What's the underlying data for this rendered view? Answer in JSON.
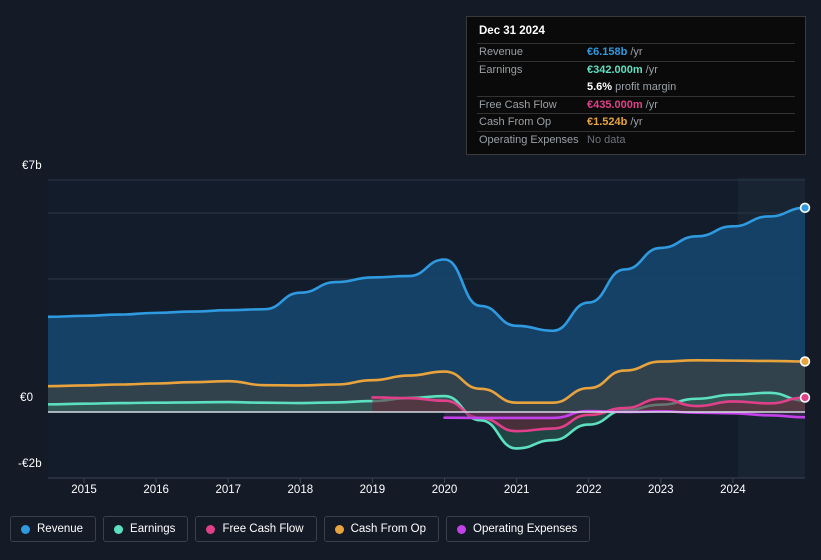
{
  "tooltip": {
    "title": "Dec 31 2024",
    "rows": [
      {
        "label": "Revenue",
        "value": "€6.158b",
        "unit": "/yr",
        "color": "#2f9ae0"
      },
      {
        "label": "Earnings",
        "value": "€342.000m",
        "unit": "/yr",
        "color": "#5ce0c0"
      },
      {
        "label": "",
        "value": "5.6%",
        "unit": "profit margin",
        "color": "#ffffff"
      },
      {
        "label": "Free Cash Flow",
        "value": "€435.000m",
        "unit": "/yr",
        "color": "#e0408a"
      },
      {
        "label": "Cash From Op",
        "value": "€1.524b",
        "unit": "/yr",
        "color": "#e8a33d"
      },
      {
        "label": "Operating Expenses",
        "value": "No data",
        "unit": "",
        "color": "#6b7178"
      }
    ]
  },
  "legend": {
    "items": [
      {
        "label": "Revenue",
        "color": "#2f9ae0"
      },
      {
        "label": "Earnings",
        "color": "#5ce0c0"
      },
      {
        "label": "Free Cash Flow",
        "color": "#e0408a"
      },
      {
        "label": "Cash From Op",
        "color": "#e8a33d"
      },
      {
        "label": "Operating Expenses",
        "color": "#c341e8"
      }
    ]
  },
  "chart_data": {
    "type": "area",
    "title": "",
    "xlabel": "",
    "ylabel": "",
    "currency": "EUR",
    "grid": true,
    "legend_position": "bottom",
    "ylim": [
      -2,
      7
    ],
    "y_ticks": [
      {
        "label": "€7b",
        "value": 7
      },
      {
        "label": "€0",
        "value": 0
      },
      {
        "label": "-€2b",
        "value": -2
      }
    ],
    "x_ticks": [
      "2015",
      "2016",
      "2017",
      "2018",
      "2019",
      "2020",
      "2021",
      "2022",
      "2023",
      "2024"
    ],
    "x": [
      2014.5,
      2015.0,
      2015.5,
      2016.0,
      2016.5,
      2017.0,
      2017.5,
      2018.0,
      2018.5,
      2019.0,
      2019.5,
      2020.0,
      2020.5,
      2021.0,
      2021.5,
      2022.0,
      2022.5,
      2023.0,
      2023.5,
      2024.0,
      2024.5,
      2025.0
    ],
    "series": [
      {
        "name": "Revenue",
        "color": "#2f9ae0",
        "fill": "#16446b",
        "units": "billions EUR",
        "values": [
          2.87,
          2.9,
          2.94,
          2.99,
          3.03,
          3.07,
          3.1,
          3.6,
          3.92,
          4.06,
          4.1,
          4.6,
          3.2,
          2.6,
          2.45,
          3.3,
          4.3,
          4.95,
          5.3,
          5.6,
          5.9,
          6.158
        ]
      },
      {
        "name": "Cash From Op",
        "color": "#e8a33d",
        "fill": "#4a4436",
        "units": "billions EUR",
        "values": [
          0.78,
          0.8,
          0.83,
          0.86,
          0.9,
          0.93,
          0.81,
          0.8,
          0.83,
          0.96,
          1.1,
          1.22,
          0.7,
          0.28,
          0.28,
          0.72,
          1.25,
          1.52,
          1.56,
          1.55,
          1.54,
          1.524
        ]
      },
      {
        "name": "Earnings",
        "color": "#5ce0c0",
        "fill": "#2f6b5e",
        "units": "billions EUR",
        "values": [
          0.23,
          0.25,
          0.27,
          0.28,
          0.29,
          0.3,
          0.28,
          0.27,
          0.29,
          0.33,
          0.42,
          0.48,
          -0.25,
          -1.1,
          -0.85,
          -0.38,
          0.05,
          0.22,
          0.4,
          0.52,
          0.58,
          0.342
        ]
      },
      {
        "name": "Free Cash Flow",
        "color": "#e0408a",
        "fill": "#6b1f33",
        "units": "billions EUR",
        "start_x": 2019.0,
        "values": [
          null,
          null,
          null,
          null,
          null,
          null,
          null,
          null,
          null,
          0.44,
          0.42,
          0.34,
          -0.18,
          -0.58,
          -0.5,
          -0.09,
          0.12,
          0.4,
          0.18,
          0.32,
          0.26,
          0.435
        ]
      },
      {
        "name": "Operating Expenses",
        "color": "#c341e8",
        "fill": "#5a2a6b",
        "units": "billions EUR",
        "start_x": 2020.0,
        "values": [
          null,
          null,
          null,
          null,
          null,
          null,
          null,
          null,
          null,
          null,
          null,
          -0.17,
          -0.18,
          -0.18,
          -0.18,
          0.03,
          0.0,
          0.02,
          -0.02,
          -0.04,
          -0.1,
          -0.16
        ]
      }
    ],
    "end_markers": [
      {
        "name": "Revenue",
        "color": "#2f9ae0",
        "value": 6.158
      },
      {
        "name": "Cash From Op",
        "color": "#e8a33d",
        "value": 1.524
      },
      {
        "name": "Free Cash Flow",
        "color": "#e0408a",
        "value": 0.435
      }
    ],
    "forecast_band_start": "2024.45"
  }
}
